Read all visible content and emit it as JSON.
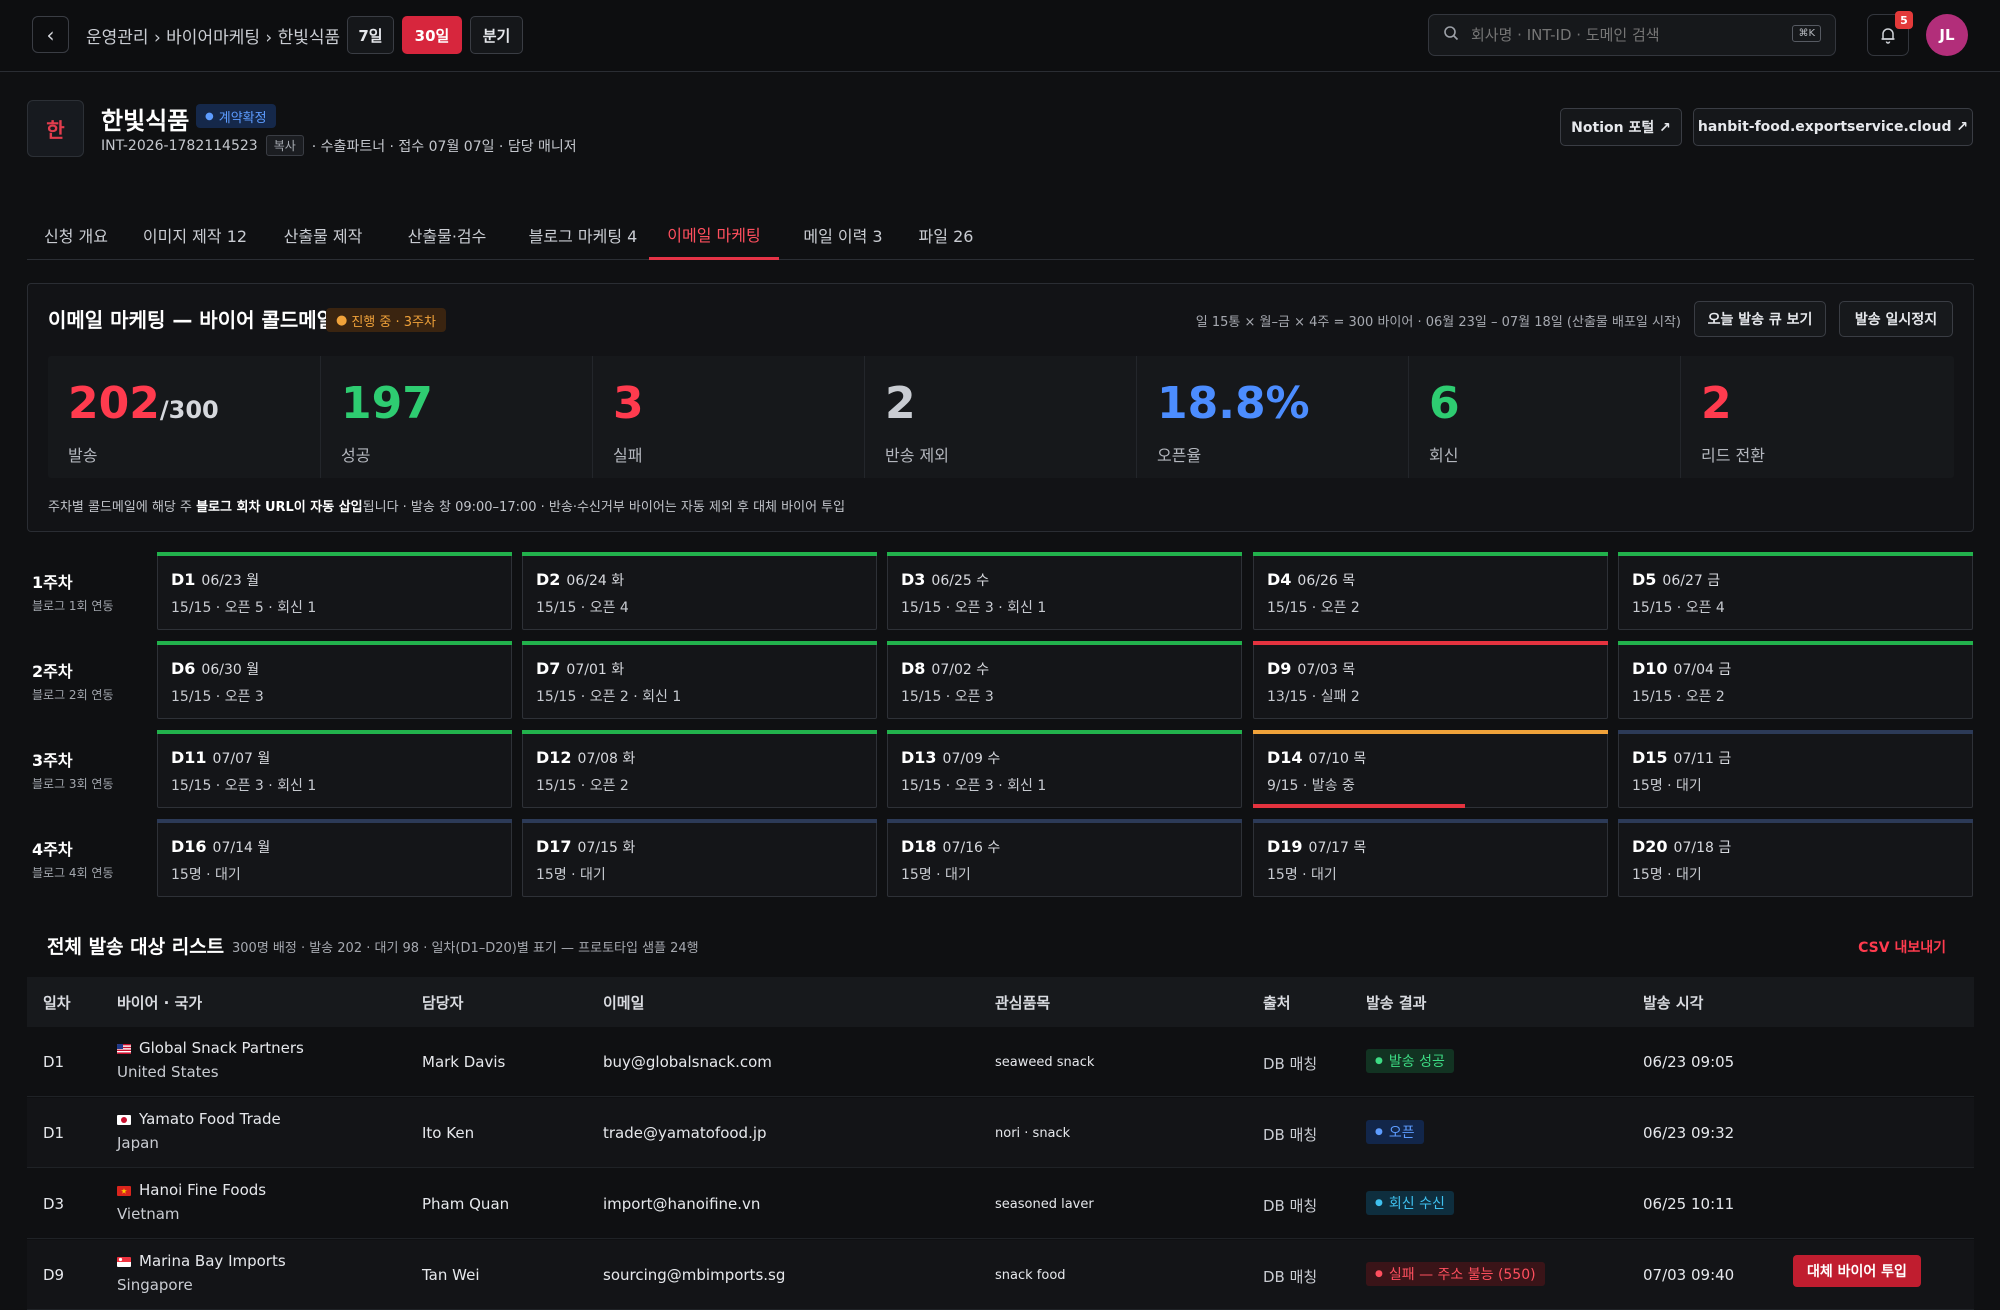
{
  "header": {
    "breadcrumb": "운영관리 › 바이어마케팅 › 한빛식품",
    "ranges": [
      "7일",
      "30일",
      "분기"
    ],
    "active_range": "30일",
    "search_placeholder": "회사명 · INT-ID · 도메인 검색",
    "shortcut": "⌘K",
    "notif_count": "5",
    "avatar": "JL"
  },
  "company": {
    "logo_char": "한",
    "name": "한빛식품",
    "status": "계약확정",
    "id": "INT-2026-1782114523",
    "copy": "복사",
    "meta": "· 수출파트너 · 접수 07월 07일 · 담당 매니저",
    "notion_btn": "Notion 포털 ↗",
    "domain_btn": "hanbit-food.exportservice.cloud ↗"
  },
  "tabs": [
    "신청 개요",
    "이미지 제작 12",
    "산출물 제작",
    "산출물·검수",
    "블로그 마케팅 4",
    "이메일 마케팅",
    "메일 이력 3",
    "파일 26"
  ],
  "panel": {
    "title": "이메일 마케팅 — 바이어 콜드메일",
    "badge": "진행 중 · 3주차",
    "info": "일 15통 × 월–금 × 4주 = 300 바이어 · 06월 23일 – 07월 18일 (산출물 배포일 시작)",
    "btn_queue": "오늘 발송 큐 보기",
    "btn_pause": "발송 일시정지",
    "note_pre": "주차별 콜드메일에 해당 주 ",
    "note_bold": "블로그 회차 URL이 자동 삽입",
    "note_post": "됩니다 · 발송 창 09:00–17:00 · 반송·수신거부 바이어는 자동 제외 후 대체 바이어 투입"
  },
  "stats": [
    {
      "value": "202",
      "sub": "/300",
      "label": "발송",
      "color": "#ff3b4e"
    },
    {
      "value": "197",
      "sub": "",
      "label": "성공",
      "color": "#2ecc71"
    },
    {
      "value": "3",
      "sub": "",
      "label": "실패",
      "color": "#ff3b4e"
    },
    {
      "value": "2",
      "sub": "",
      "label": "반송 제외",
      "color": "#c9ccd2"
    },
    {
      "value": "18.8%",
      "sub": "",
      "label": "오픈율",
      "color": "#4c8dff"
    },
    {
      "value": "6",
      "sub": "",
      "label": "회신",
      "color": "#2ecc71"
    },
    {
      "value": "2",
      "sub": "",
      "label": "리드 전환",
      "color": "#ff3b4e"
    }
  ],
  "weeks": [
    {
      "title": "1주차",
      "sub": "블로그 1회 연동",
      "days": [
        {
          "id": "D1",
          "date": "06/23 월",
          "detail": "15/15 · 오픈 5 · 회신 1",
          "status": "done"
        },
        {
          "id": "D2",
          "date": "06/24 화",
          "detail": "15/15 · 오픈 4",
          "status": "done"
        },
        {
          "id": "D3",
          "date": "06/25 수",
          "detail": "15/15 · 오픈 3 · 회신 1",
          "status": "done"
        },
        {
          "id": "D4",
          "date": "06/26 목",
          "detail": "15/15 · 오픈 2",
          "status": "done"
        },
        {
          "id": "D5",
          "date": "06/27 금",
          "detail": "15/15 · 오픈 4",
          "status": "done"
        }
      ]
    },
    {
      "title": "2주차",
      "sub": "블로그 2회 연동",
      "days": [
        {
          "id": "D6",
          "date": "06/30 월",
          "detail": "15/15 · 오픈 3",
          "status": "done"
        },
        {
          "id": "D7",
          "date": "07/01 화",
          "detail": "15/15 · 오픈 2 · 회신 1",
          "status": "done"
        },
        {
          "id": "D8",
          "date": "07/02 수",
          "detail": "15/15 · 오픈 3",
          "status": "done"
        },
        {
          "id": "D9",
          "date": "07/03 목",
          "detail": "13/15 · 실패 2",
          "status": "fail"
        },
        {
          "id": "D10",
          "date": "07/04 금",
          "detail": "15/15 · 오픈 2",
          "status": "done"
        }
      ]
    },
    {
      "title": "3주차",
      "sub": "블로그 3회 연동",
      "days": [
        {
          "id": "D11",
          "date": "07/07 월",
          "detail": "15/15 · 오픈 3 · 회신 1",
          "status": "done"
        },
        {
          "id": "D12",
          "date": "07/08 화",
          "detail": "15/15 · 오픈 2",
          "status": "done"
        },
        {
          "id": "D13",
          "date": "07/09 수",
          "detail": "15/15 · 오픈 3 · 회신 1",
          "status": "done"
        },
        {
          "id": "D14",
          "date": "07/10 목",
          "detail": "9/15 · 발송 중",
          "status": "active",
          "progress": 0.6
        },
        {
          "id": "D15",
          "date": "07/11 금",
          "detail": "15명 · 대기",
          "status": "wait"
        }
      ]
    },
    {
      "title": "4주차",
      "sub": "블로그 4회 연동",
      "days": [
        {
          "id": "D16",
          "date": "07/14 월",
          "detail": "15명 · 대기",
          "status": "wait"
        },
        {
          "id": "D17",
          "date": "07/15 화",
          "detail": "15명 · 대기",
          "status": "wait"
        },
        {
          "id": "D18",
          "date": "07/16 수",
          "detail": "15명 · 대기",
          "status": "wait"
        },
        {
          "id": "D19",
          "date": "07/17 목",
          "detail": "15명 · 대기",
          "status": "wait"
        },
        {
          "id": "D20",
          "date": "07/18 금",
          "detail": "15명 · 대기",
          "status": "wait"
        }
      ]
    }
  ],
  "list": {
    "title": "전체 발송 대상 리스트",
    "summary": "300명 배정 · 발송 202 · 대기 98 · 일차(D1–D20)별 표기 — 프로토타입 샘플 24행",
    "csv": "CSV 내보내기",
    "columns": [
      "일차",
      "바이어 · 국가",
      "담당자",
      "이메일",
      "관심품목",
      "출처",
      "발송 결과",
      "발송 시각"
    ],
    "rows": [
      {
        "day": "D1",
        "buyer": "Global Snack Partners",
        "country": "United States",
        "contact": "Mark Davis",
        "email": "buy@globalsnack.com",
        "item": "seaweed snack",
        "source": "DB 매칭",
        "result": "발송 성공",
        "rtype": "ok",
        "time": "06/23 09:05",
        "flag": "us"
      },
      {
        "day": "D1",
        "buyer": "Yamato Food Trade",
        "country": "Japan",
        "contact": "Ito Ken",
        "email": "trade@yamatofood.jp",
        "item": "nori · snack",
        "source": "DB 매칭",
        "result": "오픈",
        "rtype": "open",
        "time": "06/23 09:32",
        "flag": "jp"
      },
      {
        "day": "D3",
        "buyer": "Hanoi Fine Foods",
        "country": "Vietnam",
        "contact": "Pham Quan",
        "email": "import@hanoifine.vn",
        "item": "seasoned laver",
        "source": "DB 매칭",
        "result": "회신 수신",
        "rtype": "reply",
        "time": "06/25 10:11",
        "flag": "vn"
      },
      {
        "day": "D9",
        "buyer": "Marina Bay Imports",
        "country": "Singapore",
        "contact": "Tan Wei",
        "email": "sourcing@mbimports.sg",
        "item": "snack food",
        "source": "DB 매칭",
        "result": "실패 — 주소 불능 (550)",
        "rtype": "fail",
        "time": "07/03 09:40",
        "flag": "sg",
        "action": "대체 바이어 투입"
      }
    ]
  },
  "colors": {
    "accent": "#e53346",
    "ok": "#2ecc71",
    "open": "#4c8dff",
    "warn": "#f0a23a",
    "wait": "#2c3a57"
  }
}
